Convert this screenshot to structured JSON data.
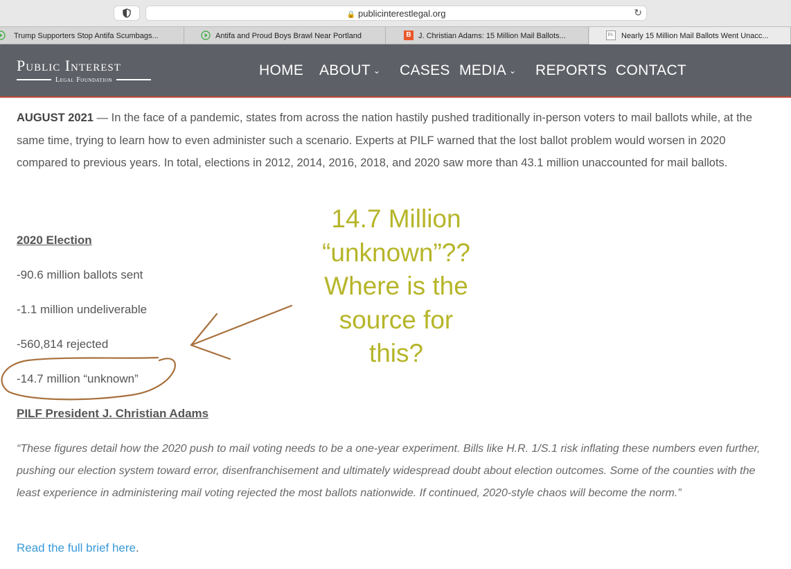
{
  "browser": {
    "url": "publicinterestlegal.org",
    "tabs": [
      {
        "title": "Trump Supporters Stop Antifa Scumbags..."
      },
      {
        "title": "Antifa and Proud Boys Brawl Near Portland"
      },
      {
        "title": "J. Christian Adams: 15 Million Mail Ballots..."
      },
      {
        "title": "Nearly 15 Million Mail Ballots Went Unacc..."
      }
    ],
    "favicon_b": "B",
    "favicon_pi": "P.I."
  },
  "site": {
    "logo_main": "Public Interest",
    "logo_sub": "Legal Foundation",
    "nav": [
      {
        "label": "HOME"
      },
      {
        "label": "ABOUT"
      },
      {
        "label": "CASES"
      },
      {
        "label": "MEDIA"
      },
      {
        "label": "REPORTS"
      },
      {
        "label": "CONTACT"
      }
    ],
    "nav_caret": "⌄",
    "header_color": "#5d6066",
    "accent_red": "#c2493a"
  },
  "article": {
    "dateline": "AUGUST 2021",
    "intro": " — In the face of a pandemic, states from across the nation hastily pushed traditionally in-person voters to mail ballots while, at the same time, trying to learn how to even administer such a scenario. Experts at PILF warned that the lost ballot problem would worsen in 2020 compared to previous years. In total, elections in 2012, 2014, 2016, 2018, and 2020 saw more than 43.1 million unaccounted for mail ballots.",
    "section_heading": "2020 Election",
    "stats": [
      "-90.6 million ballots sent",
      "-1.1 million undeliverable",
      "-560,814 rejected",
      "-14.7 million “unknown”"
    ],
    "quote_heading": "PILF President J. Christian Adams",
    "quote": "“These figures detail how the 2020 push to mail voting needs to be a one-year experiment. Bills like H.R. 1/S.1 risk inflating these numbers even further, pushing our election system toward error, disenfranchisement and ultimately widespread doubt about election outcomes. Some of the counties with the least experience in administering mail voting rejected the most ballots nationwide. If continued, 2020-style chaos will become the norm.”",
    "read_more": "Read the full brief here",
    "read_more_period": ".",
    "link_color": "#3a9ad9"
  },
  "annotation": {
    "lines": [
      "14.7 Million",
      "“unknown”??",
      "Where is the",
      "source for",
      "this?"
    ],
    "text_color": "#b6b529",
    "ink_color": "#a8703c"
  }
}
